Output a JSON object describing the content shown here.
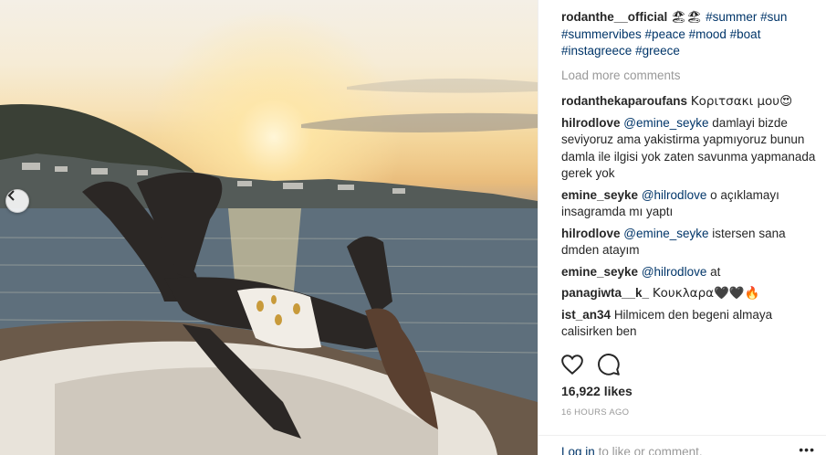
{
  "post": {
    "caption": {
      "user": "rodanthe__official",
      "emoji": "🏖🏖",
      "hashtags": [
        "#summer",
        "#sun",
        "#summervibes",
        "#peace",
        "#mood",
        "#boat",
        "#instagreece",
        "#greece"
      ]
    },
    "load_more": "Load more comments",
    "comments": [
      {
        "user": "rodanthekaparoufans",
        "text": "Κοριτσακι μου😍"
      },
      {
        "user": "hilrodlove",
        "mention": "@emine_seyke",
        "text": "damlayi bizde seviyoruz ama yakistirma yapmıyoruz bunun damla ile ilgisi yok zaten savunma yapmanada gerek yok"
      },
      {
        "user": "emine_seyke",
        "mention": "@hilrodlove",
        "text": "o açıklamayı insagramda mı yaptı"
      },
      {
        "user": "hilrodlove",
        "mention": "@emine_seyke",
        "text": "istersen sana dmden atayım"
      },
      {
        "user": "emine_seyke",
        "mention": "@hilrodlove",
        "text": "at"
      },
      {
        "user": "panagiwta__k_",
        "text": "Κουκλαρα🖤🖤🔥"
      },
      {
        "user": "ist_an34",
        "text": "Hilmicem den begeni almaya calisirken ben"
      }
    ],
    "likes": "16,922 likes",
    "time": "16 HOURS AGO",
    "footer": {
      "login": "Log in",
      "rest": "to like or comment."
    },
    "more": "•••",
    "icons": {
      "like": "heart-icon",
      "comment": "comment-icon",
      "prev": "chevron-left-icon"
    }
  }
}
